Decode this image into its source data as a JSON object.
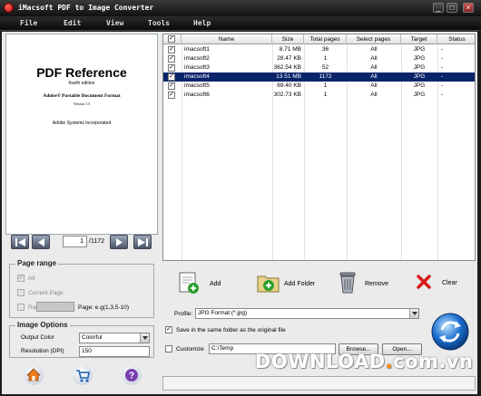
{
  "window": {
    "title": "iMacsoft PDF to Image Converter"
  },
  "menu": [
    "File",
    "Edit",
    "View",
    "Tools",
    "Help"
  ],
  "preview": {
    "title": "PDF Reference",
    "edition": "fourth edition",
    "subtitle": "Adobe® Portable Document Format",
    "version": "Version 1.5",
    "publisher": "Adobe Systems Incorporated"
  },
  "navigation": {
    "current_page": "1",
    "total_pages": "/1172"
  },
  "page_range": {
    "legend": "Page range",
    "all_label": "All",
    "all_checked": true,
    "current_label": "Current Page",
    "range_label": "Range",
    "range_hint": "Page: e.g(1,3,5-10)"
  },
  "image_options": {
    "legend": "Image Options",
    "output_color_label": "Output Color",
    "output_color_value": "Colorful",
    "resolution_label": "Resolution (DPI)",
    "resolution_value": "150"
  },
  "file_table": {
    "columns": [
      "Name",
      "Size",
      "Total pages",
      "Select pages",
      "Target",
      "Status"
    ],
    "rows": [
      {
        "checked": true,
        "name": "imacsoft1",
        "size": "8.71 MB",
        "total": "36",
        "select": "All",
        "target": "JPG",
        "status": "-",
        "selected": false
      },
      {
        "checked": true,
        "name": "imacsoft2",
        "size": "28.47 KB",
        "total": "1",
        "select": "All",
        "target": "JPG",
        "status": "-",
        "selected": false
      },
      {
        "checked": true,
        "name": "imacsoft3",
        "size": "362.54 KB",
        "total": "52",
        "select": "All",
        "target": "JPG",
        "status": "-",
        "selected": false
      },
      {
        "checked": true,
        "name": "imacsoft4",
        "size": "13.51 MB",
        "total": "1172",
        "select": "All",
        "target": "JPG",
        "status": "-",
        "selected": true
      },
      {
        "checked": true,
        "name": "imacsoft5",
        "size": "69.40 KB",
        "total": "1",
        "select": "All",
        "target": "JPG",
        "status": "-",
        "selected": false
      },
      {
        "checked": true,
        "name": "imacsoft6",
        "size": "302.73 KB",
        "total": "1",
        "select": "All",
        "target": "JPG",
        "status": "-",
        "selected": false
      }
    ]
  },
  "toolbar": {
    "add_label": "Add",
    "add_folder_label": "Add Folder",
    "remove_label": "Remove",
    "clear_label": "Clear"
  },
  "output": {
    "profile_label": "Profile:",
    "profile_value": "JPG Format  (*.jpg)",
    "same_folder_label": "Save in the same folder as the original file",
    "same_folder_checked": true,
    "customize_label": "Customize",
    "customize_checked": false,
    "path_value": "C:\\Temp",
    "browse_label": "Browse...",
    "open_label": "Open..."
  },
  "icons": {
    "home": "home-icon",
    "cart": "cart-icon",
    "help": "help-icon",
    "convert": "convert-icon"
  },
  "watermark": {
    "text_a": "DOWNLOAD",
    "dot": ".",
    "text_b": "com.vn"
  },
  "colors": {
    "selection": "#0a246a",
    "titlebar": "#111111",
    "accent_blue": "#1a6fd0"
  }
}
